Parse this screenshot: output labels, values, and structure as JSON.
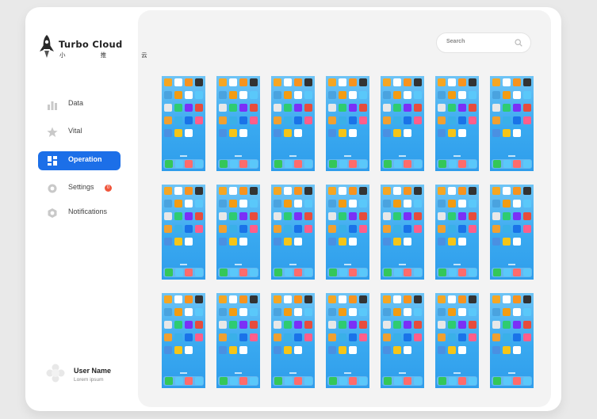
{
  "brand": {
    "name": "Turbo Cloud",
    "subtitle": "小 推 云"
  },
  "sidebar": {
    "items": [
      {
        "label": "Data",
        "icon": "bar-chart-icon",
        "active": false
      },
      {
        "label": "Vital",
        "icon": "star-icon",
        "active": false
      },
      {
        "label": "Operation",
        "icon": "dashboard-icon",
        "active": true
      },
      {
        "label": "Settings",
        "icon": "gear-icon",
        "active": false,
        "badge": "0"
      },
      {
        "label": "Notifications",
        "icon": "bell-icon",
        "active": false
      }
    ]
  },
  "search": {
    "placeholder": "Search"
  },
  "devices": {
    "rows": 3,
    "columns": 7,
    "count": 21
  },
  "user": {
    "name": "User Name",
    "subtitle": "Lorem ipsum"
  },
  "colors": {
    "accent": "#1c6fe8",
    "badge": "#f0563c",
    "background": "#e9e9e9",
    "panel": "#f3f3f3"
  }
}
